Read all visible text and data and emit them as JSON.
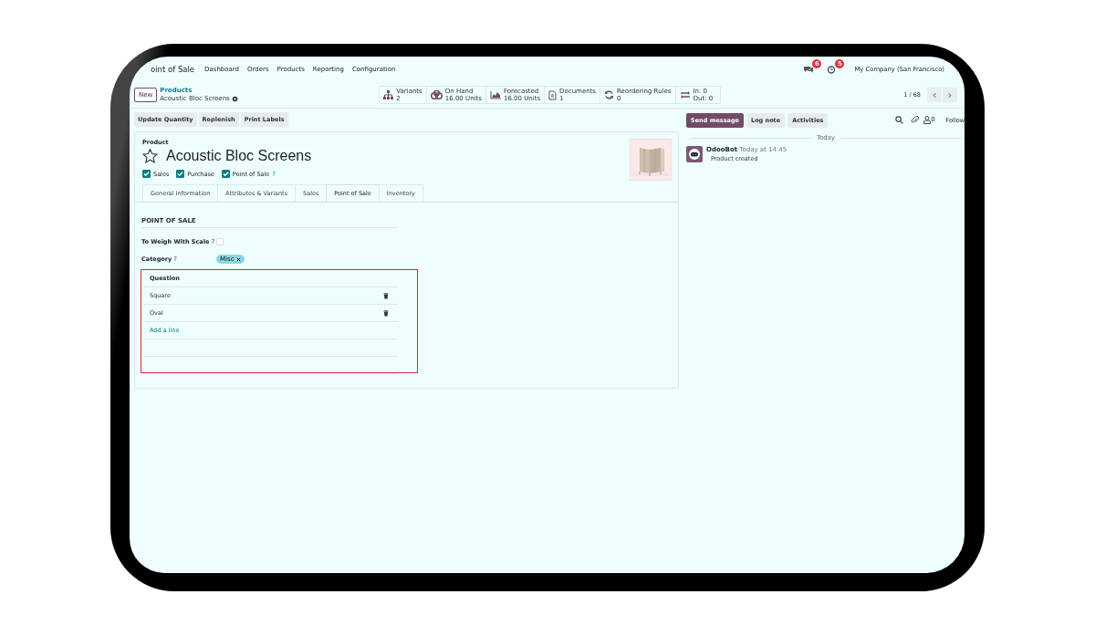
{
  "navbar": {
    "app": "oint of Sale",
    "menus": [
      "Dashboard",
      "Orders",
      "Products",
      "Reporting",
      "Configuration"
    ],
    "message_count": "6",
    "activity_count": "5",
    "company": "My Company (San Francisco)"
  },
  "control_panel": {
    "new_button": "New",
    "breadcrumb": "Products",
    "record": "Acoustic Bloc Screens",
    "stat_buttons": [
      {
        "kind": "variants",
        "label": "Variants",
        "value": "2"
      },
      {
        "kind": "on_hand",
        "label": "On Hand",
        "value": "16.00 Units"
      },
      {
        "kind": "forecast",
        "label": "Forecasted",
        "value": "16.00 Units"
      },
      {
        "kind": "documents",
        "label": "Documents",
        "value": "1"
      },
      {
        "kind": "reordering",
        "label": "Reordering Rules",
        "value": "0"
      },
      {
        "kind": "in_out",
        "label": "In: 0",
        "value": "Out: 0"
      }
    ],
    "pager": "1 / 68"
  },
  "action_buttons": [
    "Update Quantity",
    "Replenish",
    "Print Labels"
  ],
  "form": {
    "type_label": "Product",
    "name": "Acoustic Bloc Screens",
    "favorite": false,
    "checkboxes": [
      {
        "label": "Sales",
        "checked": true
      },
      {
        "label": "Purchase",
        "checked": true
      },
      {
        "label": "Point of Sale",
        "checked": true,
        "help": "?"
      }
    ],
    "tabs": [
      {
        "label": "General Information",
        "selected": false
      },
      {
        "label": "Attributes & Variants",
        "selected": false
      },
      {
        "label": "Sales",
        "selected": false
      },
      {
        "label": "Point of Sale",
        "selected": true
      },
      {
        "label": "Inventory",
        "selected": false
      }
    ],
    "section_title": "POINT OF SALE",
    "fields": [
      {
        "kind": "checkbox",
        "label": "To Weigh With Scale",
        "help": "?",
        "checked": false
      },
      {
        "kind": "tags",
        "label": "Category",
        "help": "?",
        "tags": [
          "Misc"
        ]
      }
    ],
    "question_table": {
      "column": "Question",
      "rows": [
        "Square",
        "Oval"
      ],
      "add_line": "Add a line",
      "highlighted": true
    }
  },
  "chatter": {
    "buttons": [
      {
        "label": "Send message",
        "selected": true
      },
      {
        "label": "Log note",
        "selected": false
      },
      {
        "label": "Activities",
        "selected": false
      }
    ],
    "follower_count": "0",
    "follow": "Follow",
    "date_separator": "Today",
    "messages": [
      {
        "author": "OdooBot",
        "time": "Today at 14:45",
        "body": "Product created"
      }
    ]
  }
}
